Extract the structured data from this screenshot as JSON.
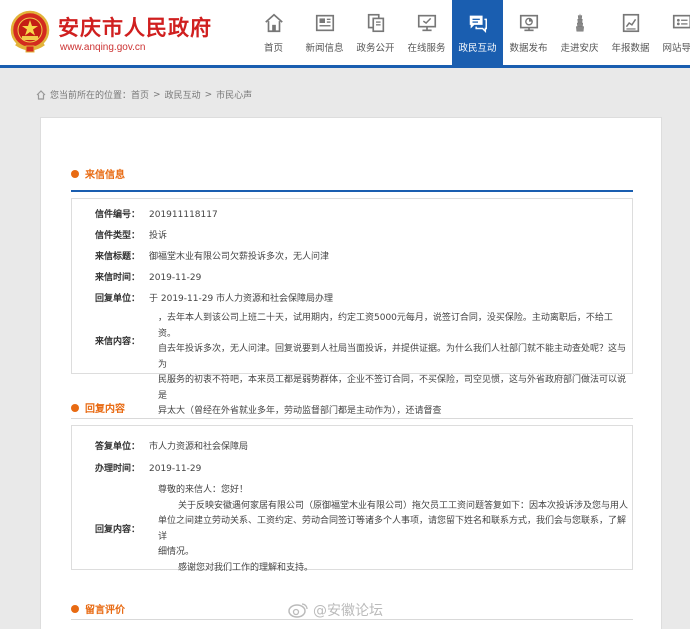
{
  "header": {
    "title": "安庆市人民政府",
    "url": "www.anqing.gov.cn"
  },
  "nav": [
    {
      "label": "首页",
      "icon": "home-icon"
    },
    {
      "label": "新闻信息",
      "icon": "news-icon"
    },
    {
      "label": "政务公开",
      "icon": "documents-icon"
    },
    {
      "label": "在线服务",
      "icon": "monitor-icon"
    },
    {
      "label": "政民互动",
      "icon": "chat-icon",
      "active": true
    },
    {
      "label": "数据发布",
      "icon": "chart-icon"
    },
    {
      "label": "走进安庆",
      "icon": "tower-icon"
    },
    {
      "label": "年报数据",
      "icon": "report-icon"
    },
    {
      "label": "网站导航",
      "icon": "nav-icon"
    }
  ],
  "breadcrumb": {
    "prefix": "您当前所在的位置：",
    "items": [
      "首页",
      "政民互动",
      "市民心声"
    ],
    "sep": ">"
  },
  "letter": {
    "section_title": "来信信息",
    "number_label": "信件编号：",
    "number": "201911118117",
    "type_label": "信件类型：",
    "type": "投诉",
    "subject_label": "来信标题：",
    "subject": "御福堂木业有限公司欠薪投诉多次，无人问津",
    "date_label": "来信时间：",
    "date": "2019-11-29",
    "handling_label": "回复单位：",
    "handling": "于 2019-11-29 市人力资源和社会保障局办理",
    "content_label": "来信内容：",
    "content_lines": [
      "，去年本人到该公司上班二十天，试用期内，约定工资5000元每月，说签订合同，没买保险。主动离职后，不给工资。",
      "自去年投诉多次，无人问津。回复说要到人社局当面投诉，并提供证据。为什么我们人社部门就不能主动查处呢？这与为",
      "民服务的初衷不符吧，本来员工都是弱势群体，企业不签订合同，不买保险，司空见惯，这与外省政府部门做法可以说是",
      "异太大（曾经在外省就业多年，劳动监督部门都是主动作为），还请督查"
    ]
  },
  "reply": {
    "section_title": "回复内容",
    "unit_label": "答复单位：",
    "unit": "市人力资源和社会保障局",
    "date_label": "办理时间：",
    "date": "2019-11-29",
    "content_label": "回复内容：",
    "greeting": "尊敬的来信人：您好！",
    "body_lines": [
      "关于反映安徽遇何家居有限公司（原御福堂木业有限公司）拖欠员工工资问题答复如下：因本次投诉涉及您与用人",
      "单位之间建立劳动关系、工资约定、劳动合同签订等诸多个人事项，请您留下姓名和联系方式，我们会与您联系，了解详",
      "细情况。"
    ],
    "closing": "感谢您对我们工作的理解和支持。"
  },
  "comments": {
    "section_title": "留言评价"
  },
  "watermark": "@安徽论坛",
  "colors": {
    "brand_blue": "#1a5eb0",
    "title_red": "#d01f1f",
    "accent_orange": "#e86a12"
  }
}
